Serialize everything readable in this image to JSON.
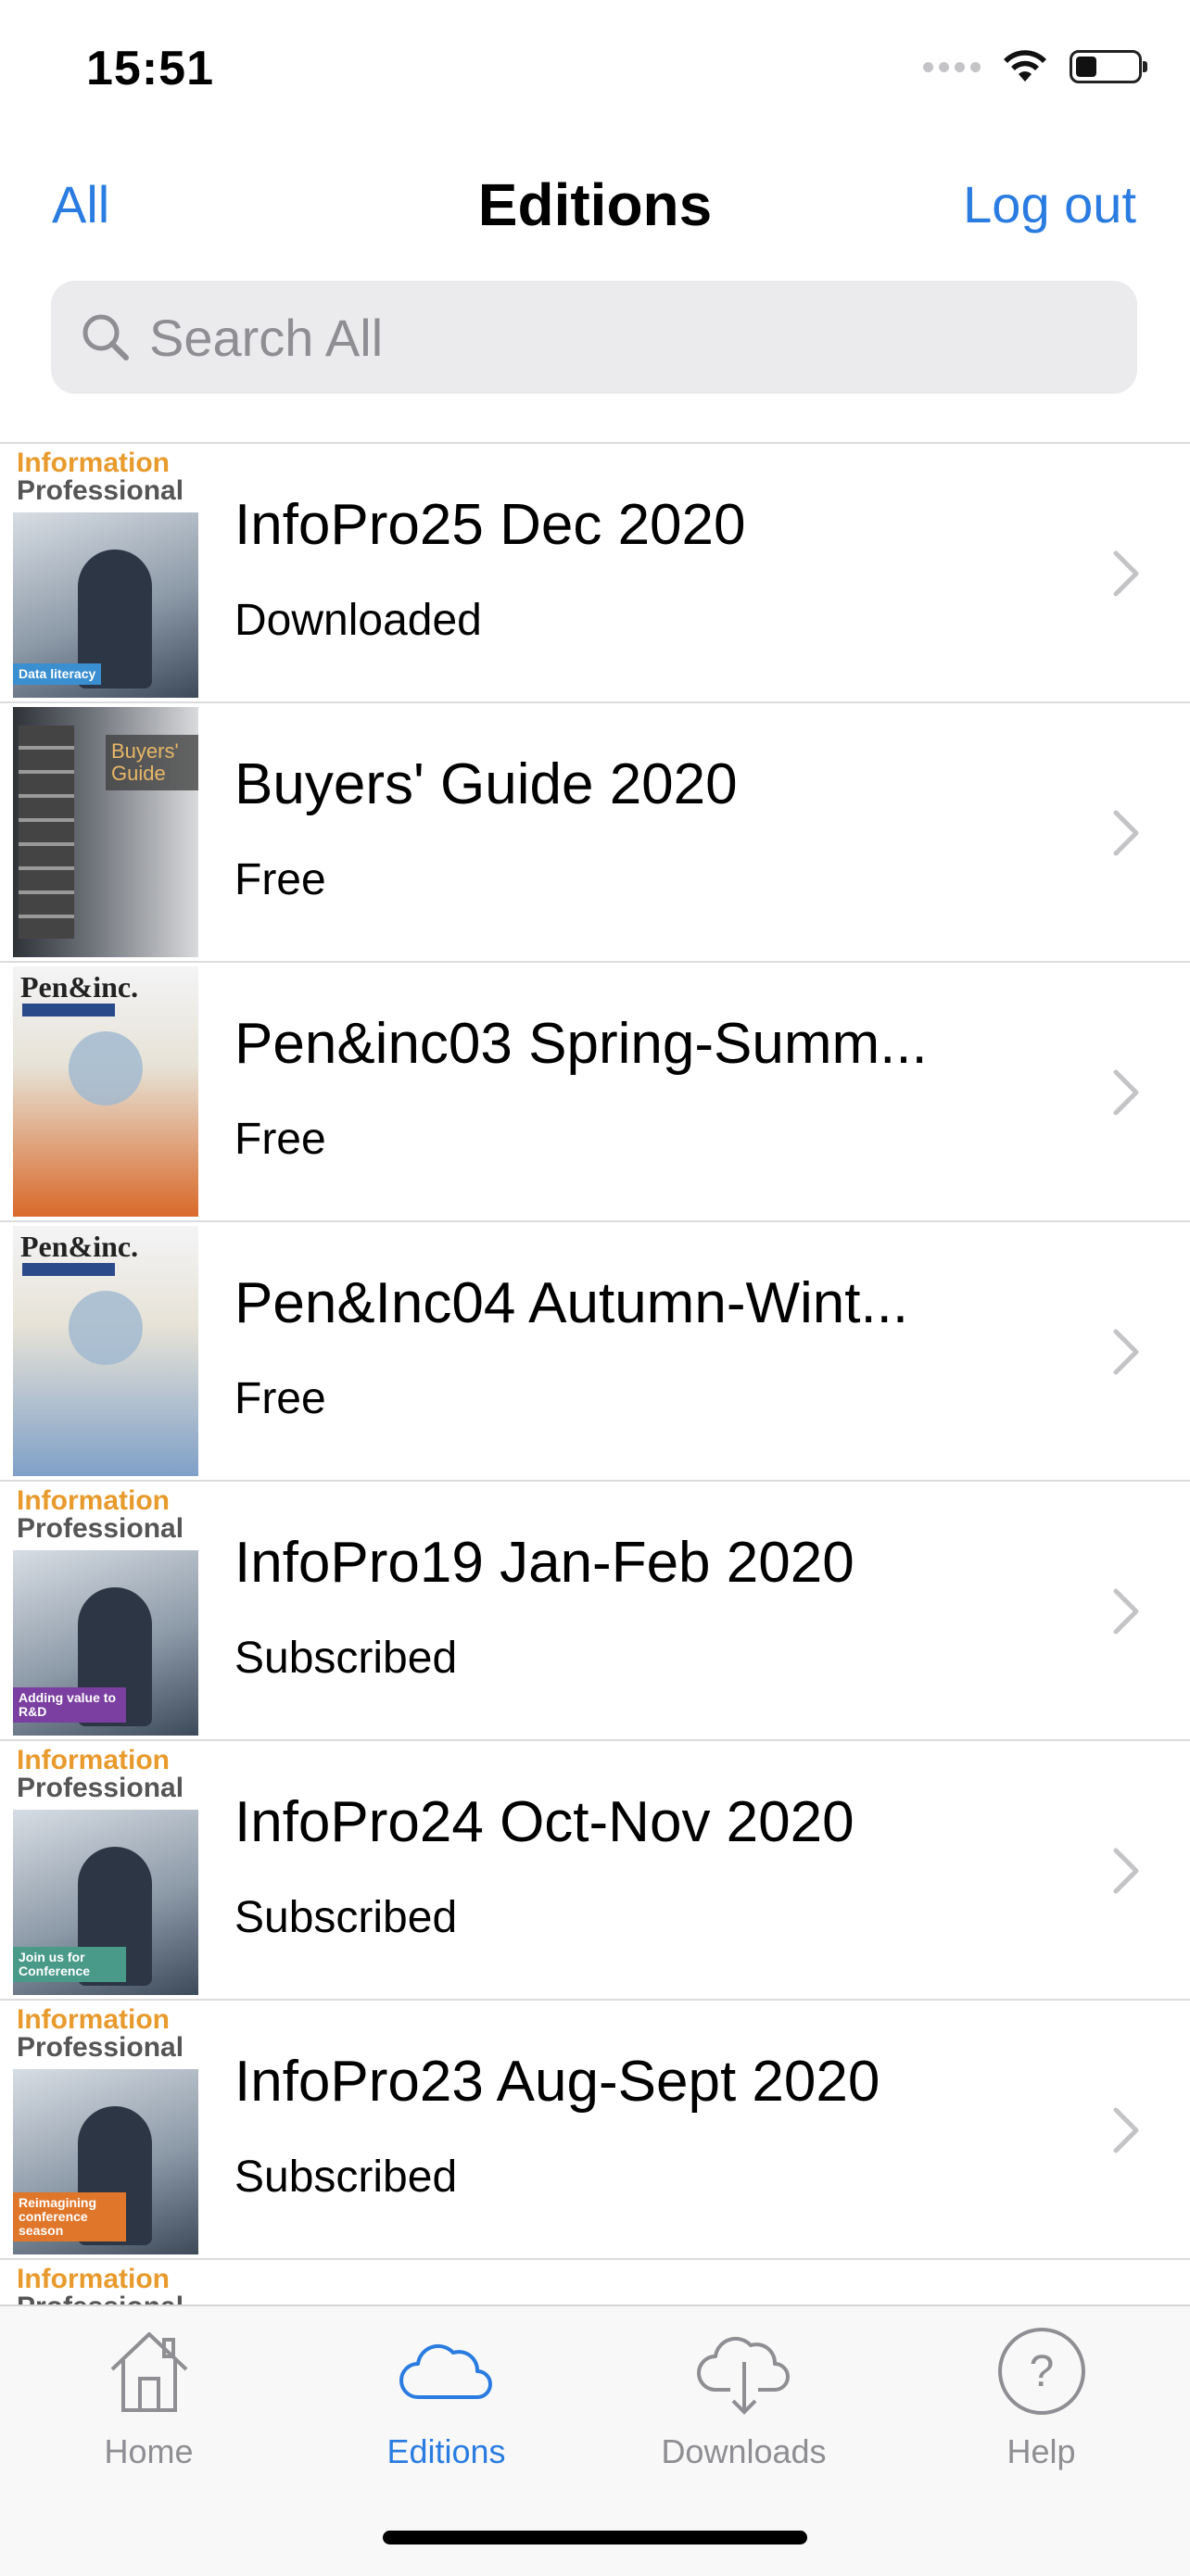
{
  "status_bar": {
    "time": "15:51",
    "battery_level": 0.35
  },
  "nav": {
    "left_label": "All",
    "title": "Editions",
    "right_label": "Log out"
  },
  "search": {
    "placeholder": "Search All"
  },
  "editions": [
    {
      "title": "InfoPro25 Dec 2020",
      "status": "Downloaded",
      "cover": "Information Professional — Data literacy",
      "cover_label": "Data literacy",
      "cover_color": "#3a8fd0"
    },
    {
      "title": "Buyers' Guide 2020",
      "status": "Free",
      "cover": "The Annual Buyers' Guide Directory 2020",
      "cover_label": "Buyers' Guide",
      "cover_color": "#9a9a9a"
    },
    {
      "title": "Pen&inc03 Spring-Summ...",
      "status": "Free",
      "cover": "Pen&inc. illustrated cover",
      "cover_label": "Pen&inc.",
      "cover_color": "#d9692a"
    },
    {
      "title": "Pen&Inc04 Autumn-Wint...",
      "status": "Free",
      "cover": "Pen&inc. field illustrated cover",
      "cover_label": "Pen&inc.",
      "cover_color": "#7fa0c8"
    },
    {
      "title": "InfoPro19 Jan-Feb 2020",
      "status": "Subscribed",
      "cover": "Information Professional — Adding value to R&D",
      "cover_label": "Adding value to R&D",
      "cover_color": "#7a3fa0"
    },
    {
      "title": "InfoPro24 Oct-Nov 2020",
      "status": "Subscribed",
      "cover": "Information Professional — Join us for Conference",
      "cover_label": "Join us for Conference",
      "cover_color": "#4a9a8a"
    },
    {
      "title": "InfoPro23 Aug-Sept 2020",
      "status": "Subscribed",
      "cover": "Information Professional — Reimagining conference season",
      "cover_label": "Reimagining conference season",
      "cover_color": "#e0762a"
    },
    {
      "title": "",
      "status": "",
      "cover": "Information Professional",
      "cover_label": "",
      "cover_color": "#e0762a"
    }
  ],
  "cover_masthead": {
    "line1": "Information",
    "line2": "Professional"
  },
  "tabs": [
    {
      "label": "Home",
      "icon": "house-icon",
      "active": false
    },
    {
      "label": "Editions",
      "icon": "cloud-icon",
      "active": true
    },
    {
      "label": "Downloads",
      "icon": "cloud-download-icon",
      "active": false
    },
    {
      "label": "Help",
      "icon": "question-mark-icon",
      "active": false
    }
  ],
  "colors": {
    "accent": "#2a7ce0",
    "inactive": "#8e8e93",
    "masthead": "#e89a2c"
  }
}
